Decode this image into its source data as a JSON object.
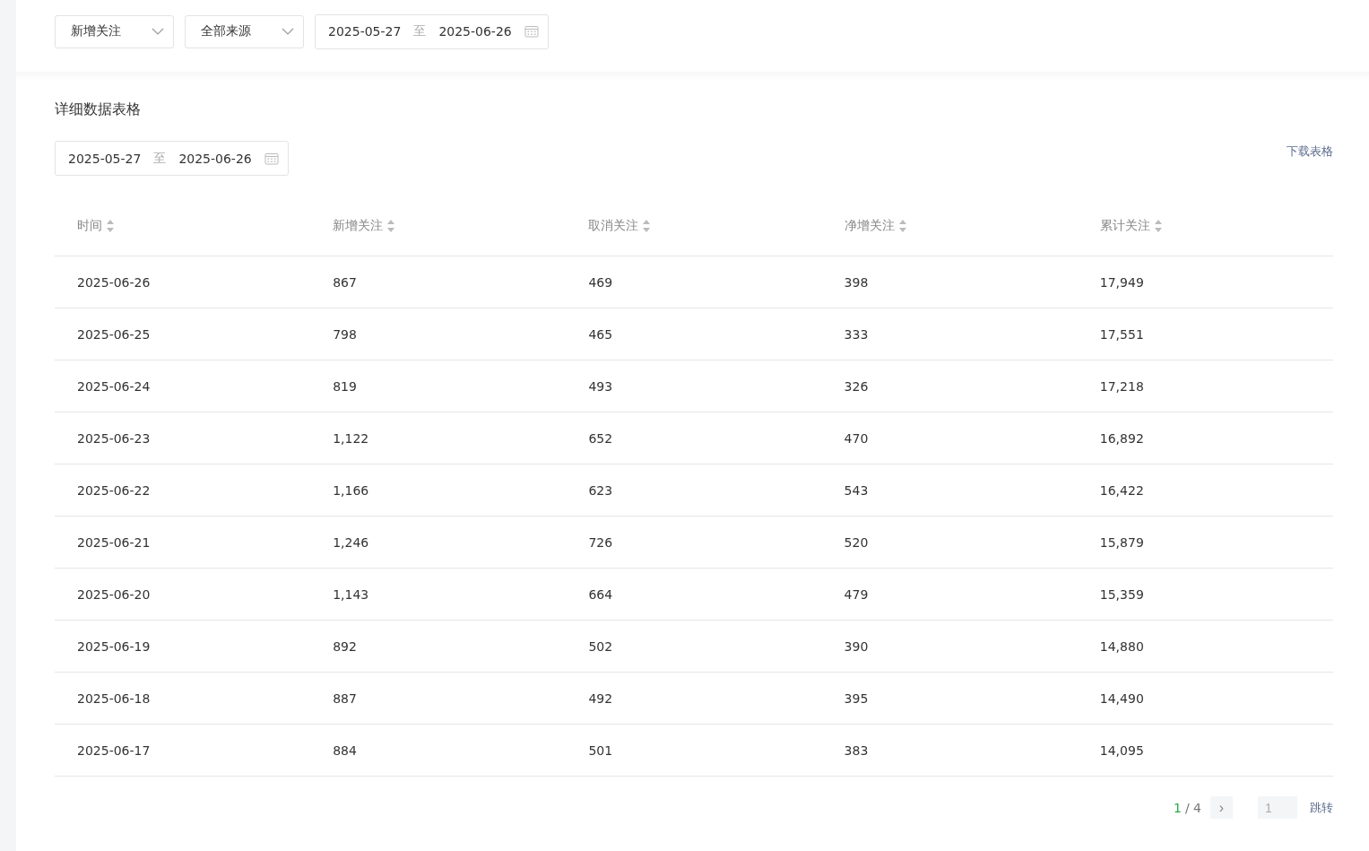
{
  "filters": {
    "metric_select": {
      "value": "新增关注"
    },
    "source_select": {
      "value": "全部来源"
    },
    "date_range": {
      "start": "2025-05-27",
      "separator": "至",
      "end": "2025-06-26"
    }
  },
  "detail": {
    "title": "详细数据表格",
    "date_range": {
      "start": "2025-05-27",
      "separator": "至",
      "end": "2025-06-26"
    },
    "download_link": "下载表格",
    "table": {
      "columns": [
        "时间",
        "新增关注",
        "取消关注",
        "净增关注",
        "累计关注"
      ],
      "rows": [
        {
          "cells": [
            "2025-06-26",
            "867",
            "469",
            "398",
            "17,949"
          ]
        },
        {
          "cells": [
            "2025-06-25",
            "798",
            "465",
            "333",
            "17,551"
          ]
        },
        {
          "cells": [
            "2025-06-24",
            "819",
            "493",
            "326",
            "17,218"
          ]
        },
        {
          "cells": [
            "2025-06-23",
            "1,122",
            "652",
            "470",
            "16,892"
          ]
        },
        {
          "cells": [
            "2025-06-22",
            "1,166",
            "623",
            "543",
            "16,422"
          ]
        },
        {
          "cells": [
            "2025-06-21",
            "1,246",
            "726",
            "520",
            "15,879"
          ]
        },
        {
          "cells": [
            "2025-06-20",
            "1,143",
            "664",
            "479",
            "15,359"
          ]
        },
        {
          "cells": [
            "2025-06-19",
            "892",
            "502",
            "390",
            "14,880"
          ]
        },
        {
          "cells": [
            "2025-06-18",
            "887",
            "492",
            "395",
            "14,490"
          ]
        },
        {
          "cells": [
            "2025-06-17",
            "884",
            "501",
            "383",
            "14,095"
          ]
        }
      ]
    },
    "pagination": {
      "current": "1",
      "total": "/ 4",
      "next": "›",
      "page_input": {
        "placeholder": "1"
      },
      "jump": "跳转"
    }
  }
}
